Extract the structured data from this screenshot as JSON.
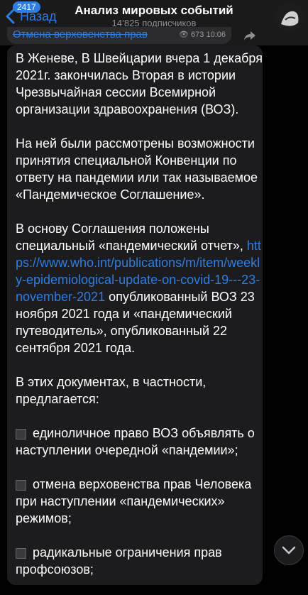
{
  "header": {
    "back_label": "Назад",
    "badge": "2417",
    "title": "Анализ мировых событий",
    "subtitle": "14’825 подписчиков"
  },
  "previous_message": {
    "text": "Отмена верховенства прав",
    "views": "673",
    "time": "10:06"
  },
  "message": {
    "p1": "В Женеве, В Швейцарии вчера 1 декабря 2021г. закончилась Вторая в истории Чрезвычайная сессии Всемирной организации здравоохранения (ВОЗ).",
    "p2": "На ней были рассмотрены возможности принятия специальной Конвенции по ответу на пандемии или так называемое «Пандемическое Соглашение».",
    "p3_before": "В основу Соглашения положены специальный «пандемический отчет», ",
    "p3_link": "https://www.who.int/publications/m/item/weekly-epidemiological-update-on-covid-19---23-november-2021",
    "p3_after": " опубликованный ВОЗ 23 ноября 2021 года и «пандемический путеводитель», опубликованный 22 сентября 2021 года.",
    "p4": "В этих документах, в частности, предлагается:",
    "bullets": [
      "единоличное право ВОЗ объявлять о наступлении очередной «пандемии»;",
      "отмена верховенства прав Человека при наступлении «пандемических» режимов;",
      "радикальные ограничения прав профсоюзов;"
    ]
  }
}
